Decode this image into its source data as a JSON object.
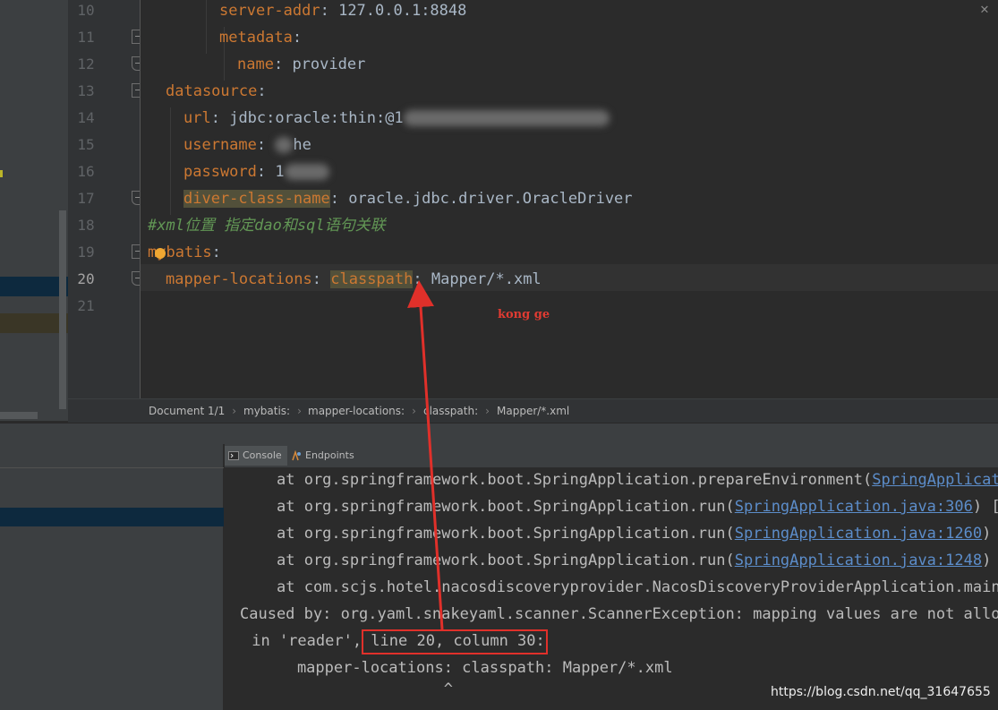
{
  "editor": {
    "line_numbers": [
      "10",
      "11",
      "12",
      "13",
      "14",
      "15",
      "16",
      "17",
      "18",
      "19",
      "20",
      "21"
    ],
    "lines": [
      {
        "key": "server-addr",
        "sep": ": ",
        "val": "127.0.0.1:8848"
      },
      {
        "key": "metadata",
        "sep": ":",
        "val": ""
      },
      {
        "key": "name",
        "sep": ": ",
        "val": "provider"
      },
      {
        "key": "datasource",
        "sep": ":",
        "val": ""
      },
      {
        "key": "url",
        "sep": ": ",
        "val": "jdbc:oracle:thin:@1"
      },
      {
        "key": "username",
        "sep": ": ",
        "val": "he"
      },
      {
        "key": "password",
        "sep": ": ",
        "val": "1"
      },
      {
        "key": "diver-class-name",
        "sep": ": ",
        "val": "oracle.jdbc.driver.OracleDriver"
      },
      {
        "comment": "#xml位置 指定dao和sql语句关联"
      },
      {
        "key": "mybatis",
        "sep": ":",
        "val": ""
      },
      {
        "key": "mapper-locations",
        "sep": ": ",
        "val_hl": "classpath",
        "val_rest": ": Mapper/*.xml"
      },
      {}
    ],
    "annotation": "kong ge",
    "close_icon": "close-icon"
  },
  "breadcrumb": {
    "items": [
      "Document 1/1",
      "mybatis:",
      "mapper-locations:",
      "classpath:",
      "Mapper/*.xml"
    ]
  },
  "tabs": [
    {
      "label": "Console",
      "icon": "console-icon"
    },
    {
      "label": "Endpoints",
      "icon": "endpoints-icon"
    }
  ],
  "console": {
    "lines": [
      {
        "prefix": "at org.springframework.boot.SpringApplication.prepareEnvironment(",
        "link": "SpringApplicatio",
        "suffix": ""
      },
      {
        "prefix": "at org.springframework.boot.SpringApplication.run(",
        "link": "SpringApplication.java:306",
        "suffix": ") [sp"
      },
      {
        "prefix": "at org.springframework.boot.SpringApplication.run(",
        "link": "SpringApplication.java:1260",
        "suffix": ") [s"
      },
      {
        "prefix": "at org.springframework.boot.SpringApplication.run(",
        "link": "SpringApplication.java:1248",
        "suffix": ") [s"
      },
      {
        "prefix": "at com.scjs.hotel.nacosdiscoveryprovider.NacosDiscoveryProviderApplication.main(",
        "link": "N",
        "suffix": ""
      },
      {
        "prefix": "Caused by: org.yaml.snakeyaml.scanner.ScannerException: mapping values are not allowe",
        "link": "",
        "suffix": ""
      },
      {
        "prefix": " in 'reader', ",
        "link": "",
        "suffix": "line 20, column 30:"
      },
      {
        "prefix": "    mapper-locations: classpath: Mapper/*.xml",
        "link": "",
        "suffix": ""
      },
      {
        "prefix": "                    ^",
        "link": "",
        "suffix": ""
      }
    ]
  },
  "watermark": "https://blog.csdn.net/qq_31647655",
  "colors": {
    "editor_bg": "#2b2b2b",
    "key": "#cc7832",
    "comment": "#629755",
    "link": "#5c8dca",
    "annotation_red": "#e0302a"
  }
}
